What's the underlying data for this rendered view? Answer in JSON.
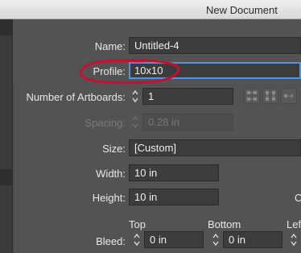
{
  "window": {
    "title": "New Document"
  },
  "form": {
    "name": {
      "label": "Name:",
      "value": "Untitled-4"
    },
    "profile": {
      "label": "Profile:",
      "value": "10x10"
    },
    "artboards": {
      "label": "Number of Artboards:",
      "value": "1"
    },
    "spacing": {
      "label": "Spacing:",
      "value": "0.28 in"
    },
    "size": {
      "label": "Size:",
      "value": "[Custom]"
    },
    "width": {
      "label": "Width:",
      "value": "10 in"
    },
    "height": {
      "label": "Height:",
      "value": "10 in"
    },
    "bleed": {
      "label": "Bleed:",
      "headers": {
        "top": "Top",
        "bottom": "Bottom",
        "left": "Lef"
      },
      "top": "0 in",
      "bottom": "0 in"
    }
  },
  "cut_off_label": "C",
  "colors": {
    "annotation": "#c8102e",
    "focus": "#5b8fd6",
    "panel": "#535353"
  },
  "icons": [
    "grid-by-row-icon",
    "grid-by-column-icon",
    "arrange-by-row-icon",
    "arrange-by-column-icon",
    "stepper-icon",
    "dropdown-caret-icon"
  ]
}
